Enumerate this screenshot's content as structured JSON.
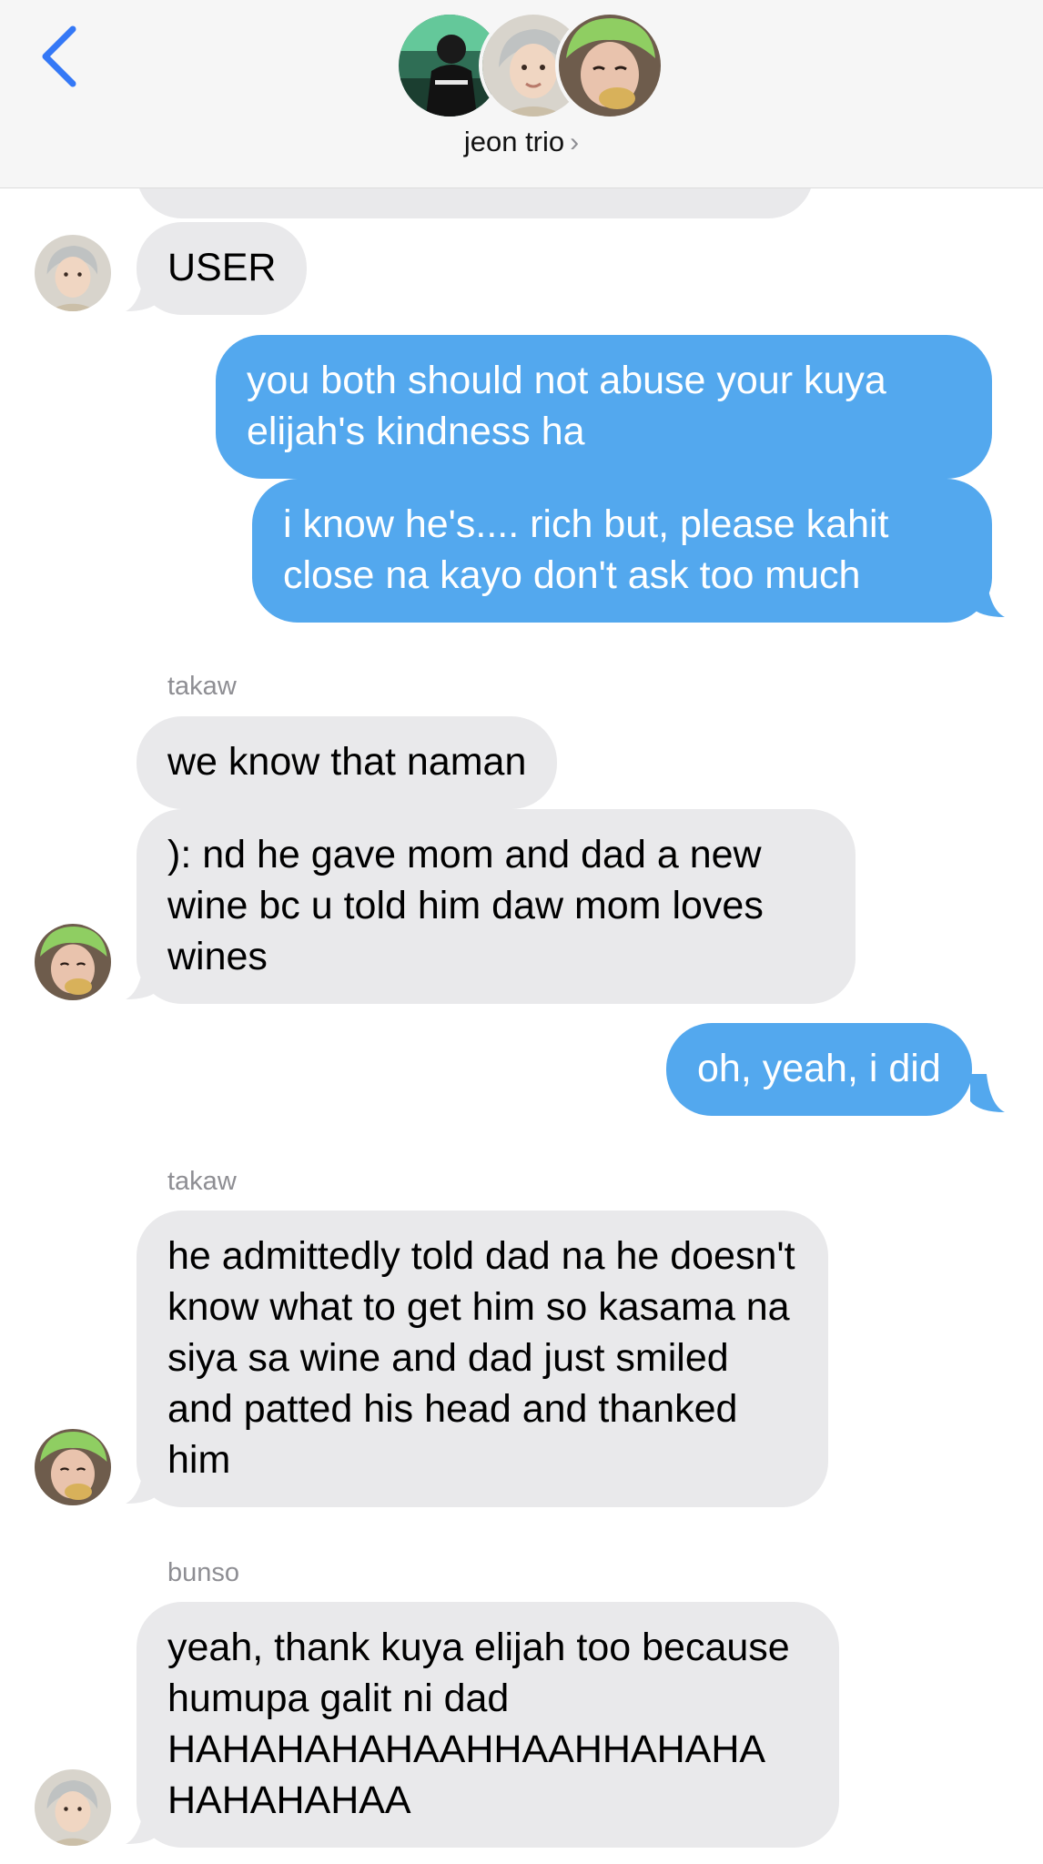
{
  "header": {
    "group_name": "jeon trio",
    "chevron": "›",
    "back_icon": "chevron-left-icon",
    "accent_color": "#3478f6"
  },
  "colors": {
    "incoming_bubble": "#e9e9eb",
    "outgoing_bubble": "#53a8ee",
    "header_bg": "#f6f6f6"
  },
  "messages": [
    {
      "direction": "incoming",
      "text": "USER"
    },
    {
      "direction": "outgoing",
      "text": "you both should not abuse your kuya elijah's kindness ha"
    },
    {
      "direction": "outgoing",
      "text": "i know he's.... rich but, please kahit close na kayo don't ask too much"
    },
    {
      "direction": "incoming",
      "sender": "takaw",
      "text": "we know that naman"
    },
    {
      "direction": "incoming",
      "text": "): nd he gave mom and dad a new wine bc u told him daw mom loves wines"
    },
    {
      "direction": "outgoing",
      "text": "oh, yeah, i did"
    },
    {
      "direction": "incoming",
      "sender": "takaw",
      "text": "he admittedly told dad na he doesn't know what to get him so kasama na siya sa wine and dad just smiled and patted his head and thanked him"
    },
    {
      "direction": "incoming",
      "sender": "bunso",
      "text": "yeah, thank kuya elijah too because humupa galit ni dad HAHAHAHAHAAHHAAHHAHAHA HAHAHAHAA"
    }
  ]
}
